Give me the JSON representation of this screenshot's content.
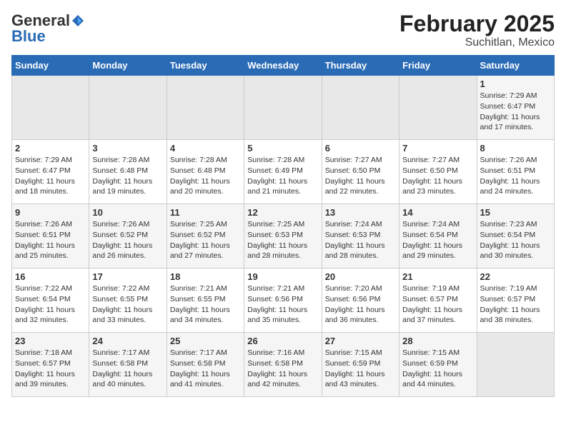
{
  "logo": {
    "line1": "General",
    "line2": "Blue"
  },
  "title": "February 2025",
  "subtitle": "Suchitlan, Mexico",
  "days_of_week": [
    "Sunday",
    "Monday",
    "Tuesday",
    "Wednesday",
    "Thursday",
    "Friday",
    "Saturday"
  ],
  "weeks": [
    [
      {
        "day": "",
        "info": ""
      },
      {
        "day": "",
        "info": ""
      },
      {
        "day": "",
        "info": ""
      },
      {
        "day": "",
        "info": ""
      },
      {
        "day": "",
        "info": ""
      },
      {
        "day": "",
        "info": ""
      },
      {
        "day": "1",
        "info": "Sunrise: 7:29 AM\nSunset: 6:47 PM\nDaylight: 11 hours and 17 minutes."
      }
    ],
    [
      {
        "day": "2",
        "info": "Sunrise: 7:29 AM\nSunset: 6:47 PM\nDaylight: 11 hours and 18 minutes."
      },
      {
        "day": "3",
        "info": "Sunrise: 7:28 AM\nSunset: 6:48 PM\nDaylight: 11 hours and 19 minutes."
      },
      {
        "day": "4",
        "info": "Sunrise: 7:28 AM\nSunset: 6:48 PM\nDaylight: 11 hours and 20 minutes."
      },
      {
        "day": "5",
        "info": "Sunrise: 7:28 AM\nSunset: 6:49 PM\nDaylight: 11 hours and 21 minutes."
      },
      {
        "day": "6",
        "info": "Sunrise: 7:27 AM\nSunset: 6:50 PM\nDaylight: 11 hours and 22 minutes."
      },
      {
        "day": "7",
        "info": "Sunrise: 7:27 AM\nSunset: 6:50 PM\nDaylight: 11 hours and 23 minutes."
      },
      {
        "day": "8",
        "info": "Sunrise: 7:26 AM\nSunset: 6:51 PM\nDaylight: 11 hours and 24 minutes."
      }
    ],
    [
      {
        "day": "9",
        "info": "Sunrise: 7:26 AM\nSunset: 6:51 PM\nDaylight: 11 hours and 25 minutes."
      },
      {
        "day": "10",
        "info": "Sunrise: 7:26 AM\nSunset: 6:52 PM\nDaylight: 11 hours and 26 minutes."
      },
      {
        "day": "11",
        "info": "Sunrise: 7:25 AM\nSunset: 6:52 PM\nDaylight: 11 hours and 27 minutes."
      },
      {
        "day": "12",
        "info": "Sunrise: 7:25 AM\nSunset: 6:53 PM\nDaylight: 11 hours and 28 minutes."
      },
      {
        "day": "13",
        "info": "Sunrise: 7:24 AM\nSunset: 6:53 PM\nDaylight: 11 hours and 28 minutes."
      },
      {
        "day": "14",
        "info": "Sunrise: 7:24 AM\nSunset: 6:54 PM\nDaylight: 11 hours and 29 minutes."
      },
      {
        "day": "15",
        "info": "Sunrise: 7:23 AM\nSunset: 6:54 PM\nDaylight: 11 hours and 30 minutes."
      }
    ],
    [
      {
        "day": "16",
        "info": "Sunrise: 7:22 AM\nSunset: 6:54 PM\nDaylight: 11 hours and 32 minutes."
      },
      {
        "day": "17",
        "info": "Sunrise: 7:22 AM\nSunset: 6:55 PM\nDaylight: 11 hours and 33 minutes."
      },
      {
        "day": "18",
        "info": "Sunrise: 7:21 AM\nSunset: 6:55 PM\nDaylight: 11 hours and 34 minutes."
      },
      {
        "day": "19",
        "info": "Sunrise: 7:21 AM\nSunset: 6:56 PM\nDaylight: 11 hours and 35 minutes."
      },
      {
        "day": "20",
        "info": "Sunrise: 7:20 AM\nSunset: 6:56 PM\nDaylight: 11 hours and 36 minutes."
      },
      {
        "day": "21",
        "info": "Sunrise: 7:19 AM\nSunset: 6:57 PM\nDaylight: 11 hours and 37 minutes."
      },
      {
        "day": "22",
        "info": "Sunrise: 7:19 AM\nSunset: 6:57 PM\nDaylight: 11 hours and 38 minutes."
      }
    ],
    [
      {
        "day": "23",
        "info": "Sunrise: 7:18 AM\nSunset: 6:57 PM\nDaylight: 11 hours and 39 minutes."
      },
      {
        "day": "24",
        "info": "Sunrise: 7:17 AM\nSunset: 6:58 PM\nDaylight: 11 hours and 40 minutes."
      },
      {
        "day": "25",
        "info": "Sunrise: 7:17 AM\nSunset: 6:58 PM\nDaylight: 11 hours and 41 minutes."
      },
      {
        "day": "26",
        "info": "Sunrise: 7:16 AM\nSunset: 6:58 PM\nDaylight: 11 hours and 42 minutes."
      },
      {
        "day": "27",
        "info": "Sunrise: 7:15 AM\nSunset: 6:59 PM\nDaylight: 11 hours and 43 minutes."
      },
      {
        "day": "28",
        "info": "Sunrise: 7:15 AM\nSunset: 6:59 PM\nDaylight: 11 hours and 44 minutes."
      },
      {
        "day": "",
        "info": ""
      }
    ]
  ]
}
